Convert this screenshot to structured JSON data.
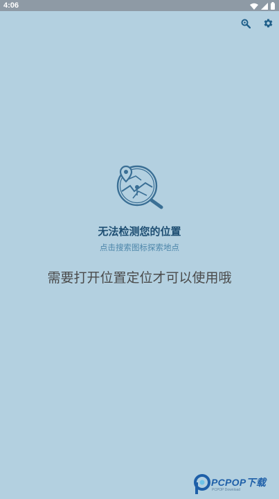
{
  "status_bar": {
    "time": "4:06"
  },
  "toolbar": {
    "search_icon": "search-icon",
    "settings_icon": "gear-icon"
  },
  "empty_state": {
    "illustration": "map-location-search",
    "title": "无法检测您的位置",
    "subtitle": "点击搜索图标探索地点",
    "message": "需要打开位置定位才可以使用哦"
  },
  "watermark": {
    "text": "PCPOP下载",
    "sub": "PCPOP Download"
  },
  "colors": {
    "background": "#b3d0e0",
    "status_bar": "#8e9aa5",
    "accent": "#1f5f8a",
    "title": "#1e4e72",
    "subtitle": "#4d86aa",
    "message": "#4a4a4a"
  }
}
